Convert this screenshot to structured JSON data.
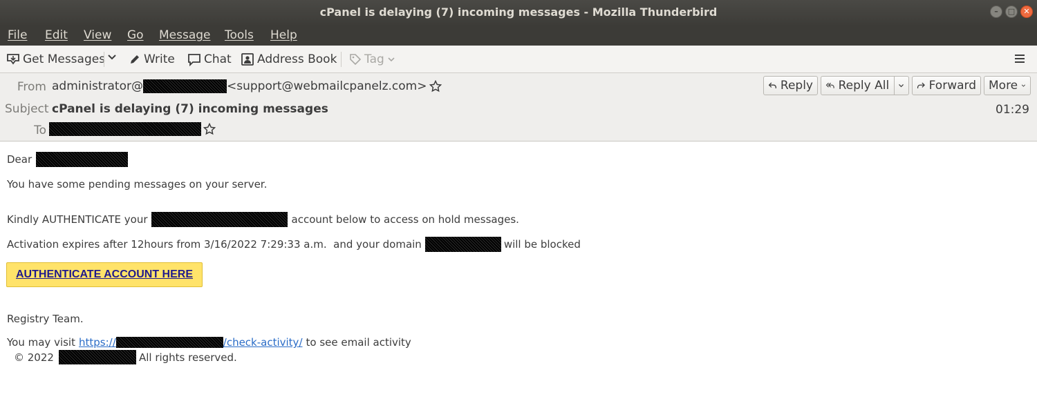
{
  "window": {
    "title": "cPanel is delaying (7) incoming messages - Mozilla Thunderbird",
    "controls": [
      "minimize",
      "maximize",
      "close"
    ]
  },
  "menu": [
    "File",
    "Edit",
    "View",
    "Go",
    "Message",
    "Tools",
    "Help"
  ],
  "toolbar": {
    "get_messages": "Get Messages",
    "write": "Write",
    "chat": "Chat",
    "address_book": "Address Book",
    "tag": "Tag"
  },
  "header": {
    "from_label": "From",
    "from_prefix": "administrator@",
    "from_address": "<support@webmailcpanelz.com>",
    "subject_label": "Subject",
    "subject": "cPanel is delaying (7) incoming messages",
    "to_label": "To",
    "time": "01:29",
    "buttons": {
      "reply": "Reply",
      "reply_all": "Reply All",
      "forward": "Forward",
      "more": "More"
    }
  },
  "body": {
    "greeting": "Dear",
    "line1": "You have some pending messages on your server.",
    "line2_a": "Kindly AUTHENTICATE your",
    "line2_b": "account below to access on hold messages.",
    "line3_a": "Activation expires after 12hours from 3/16/2022 7:29:33 a.m.  and your domain",
    "line3_b": "will be blocked",
    "cta": "AUTHENTICATE ACCOUNT HERE",
    "signature": "Registry Team.",
    "visit_a": "You may visit",
    "visit_link_a": "https://",
    "visit_link_b": "/check-activity/",
    "visit_b": "to see email activity",
    "copyright_a": "© 2022",
    "copyright_b": "All rights reserved."
  },
  "icons": {
    "window_controls": [
      "minimize-icon",
      "maximize-icon",
      "close-icon"
    ],
    "toolbar": [
      "get-messages-icon",
      "dropdown-arrow-icon",
      "pencil-icon",
      "chat-bubble-icon",
      "address-book-icon",
      "tag-icon",
      "hamburger-menu-icon"
    ],
    "header": [
      "star-icon",
      "reply-icon",
      "reply-all-icon",
      "forward-icon",
      "chevron-down-icon"
    ]
  },
  "colors": {
    "titlebar": "#3d3c38",
    "menubar": "#3c3b37",
    "close_button": "#ef6a3f",
    "cta_background": "#ffe36a",
    "cta_text": "#1f1a8c",
    "link": "#2a6cc7"
  }
}
